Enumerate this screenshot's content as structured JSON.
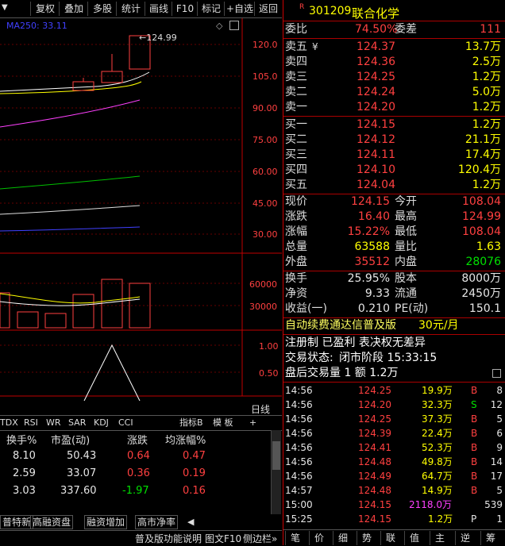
{
  "toolbar": {
    "items": [
      "复权",
      "叠加",
      "多股",
      "统计",
      "画线",
      "F10",
      "标记",
      "+自选",
      "返回"
    ]
  },
  "chart": {
    "ma_label": "MA250: 33.11",
    "high_mark": "124.99",
    "price_ticks": [
      "120.0",
      "105.0",
      "90.00",
      "75.00",
      "60.00",
      "45.00",
      "30.00"
    ],
    "vol_ticks": [
      "60000",
      "30000"
    ],
    "ind_ticks": [
      "1.00",
      "0.50"
    ],
    "xaxis_label": "日线"
  },
  "indicator_tabs": {
    "items": [
      "TDX",
      "RSI",
      "WR",
      "SAR",
      "KDJ",
      "CCI"
    ],
    "right": [
      "指标B",
      "模 板",
      "+"
    ]
  },
  "stats_table": {
    "headers": [
      "换手%",
      "市盈(动)",
      "涨跌",
      "均涨幅%"
    ],
    "rows": [
      [
        "8.10",
        "50.43",
        "0.64",
        "0.47"
      ],
      [
        "2.59",
        "33.07",
        "0.36",
        "0.19"
      ],
      [
        "3.03",
        "337.60",
        "-1.97",
        "0.16"
      ]
    ]
  },
  "bottom_tabs": [
    "普特新",
    "高融资盘",
    "融资增加",
    "高市净率"
  ],
  "bottom_bar": {
    "help": "普及版功能说明",
    "f10": "图文F10",
    "sidebar": "侧边栏»"
  },
  "stock": {
    "badge": "R",
    "code": "301209",
    "name": "联合化学"
  },
  "weibi": {
    "label": "委比",
    "value": "74.50%",
    "label2": "委差",
    "value2": "111"
  },
  "asks": [
    {
      "label": "卖五",
      "mark": "¥",
      "price": "124.37",
      "vol": "13.7万"
    },
    {
      "label": "卖四",
      "mark": "",
      "price": "124.36",
      "vol": "2.5万"
    },
    {
      "label": "卖三",
      "mark": "",
      "price": "124.25",
      "vol": "1.2万"
    },
    {
      "label": "卖二",
      "mark": "",
      "price": "124.24",
      "vol": "5.0万"
    },
    {
      "label": "卖一",
      "mark": "",
      "price": "124.20",
      "vol": "1.2万"
    }
  ],
  "bids": [
    {
      "label": "买一",
      "price": "124.15",
      "vol": "1.2万"
    },
    {
      "label": "买二",
      "price": "124.12",
      "vol": "21.1万"
    },
    {
      "label": "买三",
      "price": "124.11",
      "vol": "17.4万"
    },
    {
      "label": "买四",
      "price": "124.10",
      "vol": "120.4万"
    },
    {
      "label": "买五",
      "price": "124.04",
      "vol": "1.2万"
    }
  ],
  "quote": [
    {
      "l1": "现价",
      "v1": "124.15",
      "l2": "今开",
      "v2": "108.04"
    },
    {
      "l1": "涨跌",
      "v1": "16.40",
      "l2": "最高",
      "v2": "124.99"
    },
    {
      "l1": "涨幅",
      "v1": "15.22%",
      "l2": "最低",
      "v2": "108.04"
    },
    {
      "l1": "总量",
      "v1": "63588",
      "l2": "量比",
      "v2": "1.63"
    },
    {
      "l1": "外盘",
      "v1": "35512",
      "l2": "内盘",
      "v2": "28076"
    }
  ],
  "fund": [
    {
      "l1": "换手",
      "v1": "25.95%",
      "l2": "股本",
      "v2": "8000万"
    },
    {
      "l1": "净资",
      "v1": "9.33",
      "l2": "流通",
      "v2": "2450万"
    },
    {
      "l1": "收益(一)",
      "v1": "0.210",
      "l2": "PE(动)",
      "v2": "150.1"
    }
  ],
  "promo": {
    "text": "自动续费通达信普及版",
    "price": "30元/月"
  },
  "info": {
    "line1": "注册制 已盈利 表决权无差异",
    "status_label": "交易状态:",
    "status_value": "闭市阶段 15:33:15",
    "after": "盘后交易量 1 额 1.2万"
  },
  "ticks": [
    {
      "t": "14:56",
      "p": "124.25",
      "v": "19.9万",
      "bs": "B",
      "n": "8"
    },
    {
      "t": "14:56",
      "p": "124.20",
      "v": "32.3万",
      "bs": "S",
      "n": "12"
    },
    {
      "t": "14:56",
      "p": "124.25",
      "v": "37.3万",
      "bs": "B",
      "n": "5"
    },
    {
      "t": "14:56",
      "p": "124.39",
      "v": "22.4万",
      "bs": "B",
      "n": "6"
    },
    {
      "t": "14:56",
      "p": "124.41",
      "v": "52.3万",
      "bs": "B",
      "n": "9"
    },
    {
      "t": "14:56",
      "p": "124.48",
      "v": "49.8万",
      "bs": "B",
      "n": "14"
    },
    {
      "t": "14:56",
      "p": "124.49",
      "v": "64.7万",
      "bs": "B",
      "n": "17"
    },
    {
      "t": "14:57",
      "p": "124.48",
      "v": "14.9万",
      "bs": "B",
      "n": "5"
    },
    {
      "t": "15:00",
      "p": "124.15",
      "v": "2118.0万",
      "bs": "",
      "n": "539"
    },
    {
      "t": "15:25",
      "p": "124.15",
      "v": "1.2万",
      "bs": "P",
      "n": "1"
    }
  ],
  "right_tabs": [
    "笔",
    "价",
    "细",
    "势",
    "联",
    "值",
    "主",
    "逆",
    "筹"
  ],
  "colors": {
    "up": "#ff4040",
    "down": "#00e000",
    "accent": "#ffff00",
    "border": "#c00000"
  }
}
